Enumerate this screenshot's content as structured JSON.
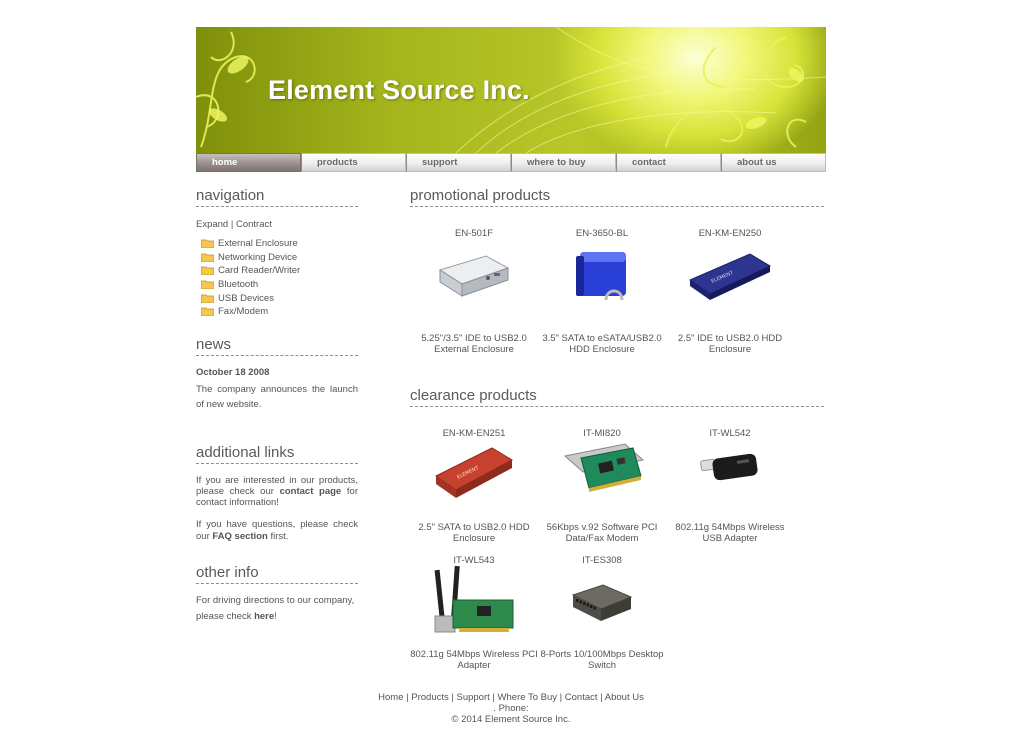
{
  "header": {
    "title": "Element Source Inc."
  },
  "nav": [
    {
      "label": "home",
      "active": true
    },
    {
      "label": "products"
    },
    {
      "label": "support"
    },
    {
      "label": "where to buy"
    },
    {
      "label": "contact"
    },
    {
      "label": "about us"
    }
  ],
  "sidebar": {
    "navigation_heading": "navigation",
    "expand": "Expand",
    "sep": "|",
    "contract": "Contract",
    "tree": [
      "External Enclosure",
      "Networking Device",
      "Card Reader/Writer",
      "Bluetooth",
      "USB Devices",
      "Fax/Modem"
    ],
    "news_heading": "news",
    "news_date": "October 18 2008",
    "news_text": "The company announces the launch of new website.",
    "links_heading": "additional links",
    "links_p1_before": "If you are interested in our products, please check our ",
    "links_p1_link": "contact page",
    "links_p1_after": " for contact information!",
    "links_p2_before": "If you have questions, please check our ",
    "links_p2_link": "FAQ section",
    "links_p2_after": " first.",
    "other_heading": "other info",
    "other_before": "For driving directions to our company, please check ",
    "other_link": "here",
    "other_after": "!"
  },
  "main": {
    "promo_heading": "promotional products",
    "clearance_heading": "clearance products",
    "promo": [
      {
        "code": "EN-501F",
        "desc": "5.25\"/3.5\" IDE to USB2.0 External Enclosure",
        "icon": "silver-enclosure-icon"
      },
      {
        "code": "EN-3650-BL",
        "desc": "3.5\" SATA to eSATA/USB2.0 HDD Enclosure",
        "icon": "blue-enclosure-icon"
      },
      {
        "code": "EN-KM-EN250",
        "desc": "2.5\" IDE to USB2.0 HDD Enclosure",
        "icon": "navy-enclosure-icon"
      }
    ],
    "clearance": [
      {
        "code": "EN-KM-EN251",
        "desc": "2.5\" SATA to USB2.0 HDD Enclosure",
        "icon": "red-enclosure-icon"
      },
      {
        "code": "IT-MI820",
        "desc": "56Kbps v.92 Software PCI Data/Fax Modem",
        "icon": "pci-modem-icon"
      },
      {
        "code": "IT-WL542",
        "desc": "802.11g 54Mbps Wireless USB Adapter",
        "icon": "usb-adapter-icon"
      },
      {
        "code": "IT-WL543",
        "desc": "802.11g 54Mbps Wireless PCI Adapter",
        "icon": "wireless-pci-icon"
      },
      {
        "code": "IT-ES308",
        "desc": "8-Ports 10/100Mbps Desktop Switch",
        "icon": "desktop-switch-icon"
      }
    ]
  },
  "footer": {
    "links": [
      "Home",
      "Products",
      "Support",
      "Where To Buy",
      "Contact",
      "About Us"
    ],
    "sep": "|",
    "phone": ". Phone:",
    "copyright": "© 2014 Element Source Inc."
  },
  "colors": {
    "banner": "#a3b41d",
    "nav_active": "#9b9090",
    "text": "#555555"
  }
}
